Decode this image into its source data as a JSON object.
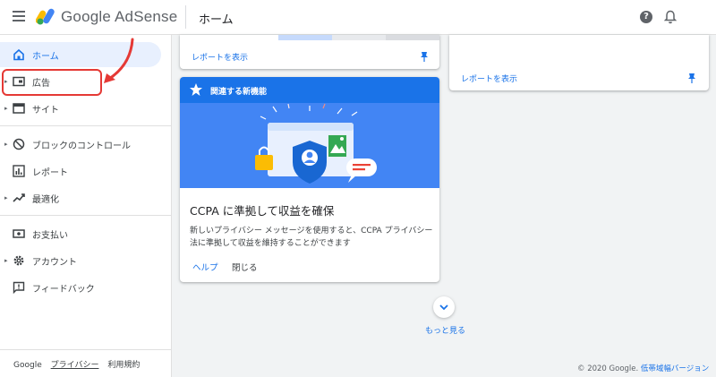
{
  "app": {
    "name": "Google AdSense"
  },
  "header": {
    "page_title": "ホーム",
    "help_icon_glyph": "?"
  },
  "sidebar": {
    "items": [
      {
        "label": "ホーム",
        "icon": "home-icon",
        "active": true
      },
      {
        "label": "広告",
        "icon": "ads-icon",
        "expandable": true,
        "highlighted": true
      },
      {
        "label": "サイト",
        "icon": "sites-icon",
        "expandable": true
      },
      {
        "label": "ブロックのコントロール",
        "icon": "block-icon",
        "expandable": true
      },
      {
        "label": "レポート",
        "icon": "reports-icon"
      },
      {
        "label": "最適化",
        "icon": "optimization-icon",
        "expandable": true
      },
      {
        "label": "お支払い",
        "icon": "payments-icon"
      },
      {
        "label": "アカウント",
        "icon": "account-icon",
        "expandable": true
      },
      {
        "label": "フィードバック",
        "icon": "feedback-icon"
      }
    ],
    "footer": {
      "google": "Google",
      "privacy": "プライバシー",
      "terms": "利用規約"
    }
  },
  "cards": {
    "top_left": {
      "link": "レポートを表示"
    },
    "top_right": {
      "link": "レポートを表示"
    },
    "feature": {
      "header": "関連する新機能",
      "title": "CCPA に準拠して収益を確保",
      "description": "新しいプライバシー メッセージを使用すると、CCPA プライバシー法に準拠して収益を維持することができます",
      "help_button": "ヘルプ",
      "close_button": "閉じる"
    }
  },
  "more": {
    "label": "もっと見る"
  },
  "footer": {
    "copyright": "© 2020 Google.",
    "low_bandwidth": "低帯域幅バージョン"
  },
  "colors": {
    "accent": "#1a73e8",
    "highlight": "#e53935",
    "illustration_bg": "#4285f4"
  }
}
